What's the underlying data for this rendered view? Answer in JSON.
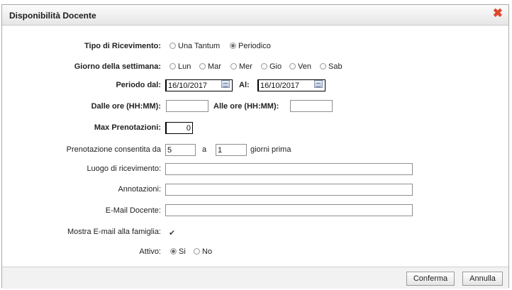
{
  "dialog": {
    "title": "Disponibilità Docente",
    "close_glyph": "✖"
  },
  "form": {
    "tipo": {
      "label": "Tipo di Ricevimento:",
      "options": [
        {
          "label": "Una Tantum",
          "selected": false
        },
        {
          "label": "Periodico",
          "selected": true
        }
      ]
    },
    "giorno": {
      "label": "Giorno della settimana:",
      "options": [
        {
          "label": "Lun",
          "selected": false
        },
        {
          "label": "Mar",
          "selected": false
        },
        {
          "label": "Mer",
          "selected": false
        },
        {
          "label": "Gio",
          "selected": false
        },
        {
          "label": "Ven",
          "selected": false
        },
        {
          "label": "Sab",
          "selected": false
        }
      ]
    },
    "periodo": {
      "label": "Periodo dal:",
      "from_value": "16/10/2017",
      "to_label": "Al:",
      "to_value": "16/10/2017",
      "calendar_icon": "calendar-icon"
    },
    "orario": {
      "from_label": "Dalle ore (HH:MM):",
      "from_value": "",
      "to_label": "Alle ore (HH:MM):",
      "to_value": ""
    },
    "max": {
      "label": "Max Prenotazioni:",
      "value": "0"
    },
    "prenotazione": {
      "label": "Prenotazione consentita da",
      "from_value": "5",
      "mid_label": "a",
      "to_value": "1",
      "suffix": "giorni prima"
    },
    "luogo": {
      "label": "Luogo di ricevimento:",
      "value": ""
    },
    "annotazioni": {
      "label": "Annotazioni:",
      "value": ""
    },
    "email": {
      "label": "E-Mail Docente:",
      "value": ""
    },
    "mostra": {
      "label": "Mostra E-mail alla famiglia:",
      "checked": true,
      "glyph": "✔"
    },
    "attivo": {
      "label": "Attivo:",
      "options": [
        {
          "label": "Si",
          "selected": true
        },
        {
          "label": "No",
          "selected": false
        }
      ]
    }
  },
  "footer": {
    "confirm_label": "Conferma",
    "cancel_label": "Annulla"
  }
}
